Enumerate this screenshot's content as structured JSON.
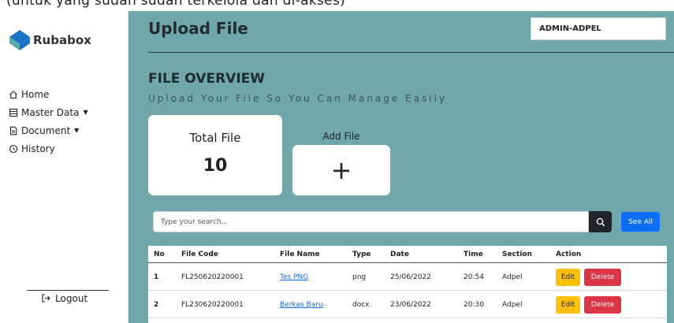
{
  "top_strip": {
    "text": "(untuk yang sudah sudah terkelola dan di-akses)"
  },
  "sidebar": {
    "brand_name": "Rubabox",
    "items": [
      {
        "label": "Home",
        "icon": "home-icon",
        "has_caret": false
      },
      {
        "label": "Master Data",
        "icon": "table-icon",
        "has_caret": true
      },
      {
        "label": "Document",
        "icon": "document-icon",
        "has_caret": true
      },
      {
        "label": "History",
        "icon": "history-icon",
        "has_caret": false
      }
    ],
    "logout_label": "Logout"
  },
  "header": {
    "title": "Upload File",
    "user": "ADMIN-ADPEL"
  },
  "overview": {
    "title": "FILE OVERVIEW",
    "subtitle": "Upload Your File So You Can Manage Easily",
    "total_label": "Total File",
    "total_value": "10",
    "add_label": "Add File",
    "add_symbol": "+"
  },
  "search": {
    "placeholder": "Type your search...",
    "see_all_label": "See All"
  },
  "table": {
    "headers": [
      "No",
      "File Code",
      "File Name",
      "Type",
      "Date",
      "Time",
      "Section",
      "Action"
    ],
    "rows": [
      {
        "no": "1",
        "code": "FL250620220001",
        "name": "Tes PNG",
        "type": "png",
        "date": "25/06/2022",
        "time": "20:54",
        "section": "Adpel"
      },
      {
        "no": "2",
        "code": "FL230620220001",
        "name": "Berkas Baru",
        "type": "docx",
        "date": "23/06/2022",
        "time": "20:30",
        "section": "Adpel"
      }
    ],
    "edit_label": "Edit",
    "delete_label": "Delete"
  },
  "colors": {
    "main_bg": "#6fa7ab",
    "edit": "#ffc107",
    "delete": "#dc3545",
    "see_all": "#0d6efd",
    "logo_blue": "#1a73c9",
    "logo_teal": "#5fa7a8"
  }
}
